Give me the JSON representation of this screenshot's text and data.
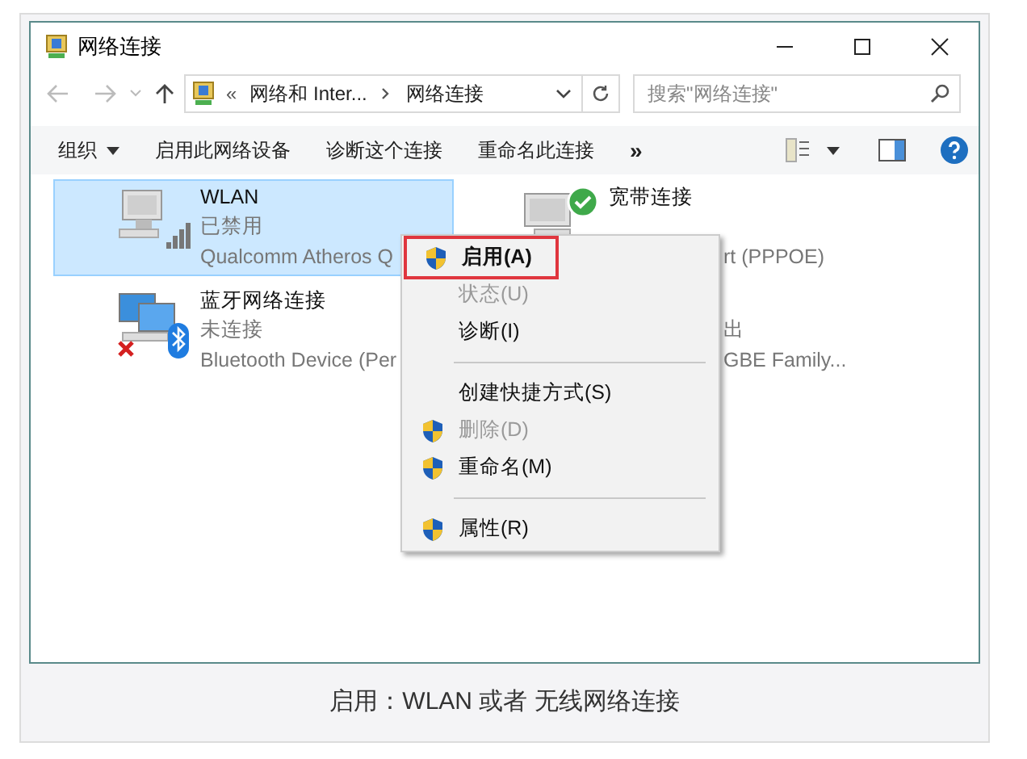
{
  "window": {
    "title": "网络连接"
  },
  "address_bar": {
    "overflow": "«",
    "segments": [
      "网络和 Inter...",
      "网络连接"
    ]
  },
  "search": {
    "placeholder": "搜索\"网络连接\""
  },
  "toolbar": [
    {
      "label": "组织",
      "kind": "dropdown"
    },
    {
      "label": "启用此网络设备",
      "kind": "button"
    },
    {
      "label": "诊断这个连接",
      "kind": "button"
    },
    {
      "label": "重命名此连接",
      "kind": "button"
    },
    {
      "label": "»",
      "kind": "more"
    }
  ],
  "connections": [
    {
      "name": "WLAN",
      "status": "已禁用",
      "device": "Qualcomm Atheros Q",
      "kind": "wireless",
      "selected": true,
      "covered": false
    },
    {
      "name": "宽带连接",
      "device": "rt (PPPOE)",
      "kind": "broadband",
      "selected": false,
      "covered": true
    },
    {
      "name": "蓝牙网络连接",
      "status": "未连接",
      "device": "Bluetooth Device (Per",
      "kind": "bluetooth",
      "selected": false,
      "covered": false
    },
    {
      "status": "出",
      "device": "GBE Family...",
      "kind": "ethernet",
      "selected": false,
      "covered": true
    }
  ],
  "context_menu": [
    {
      "kind": "item",
      "label": "启用(A)",
      "shield": true,
      "disabled": false,
      "default": true,
      "highlighted": true
    },
    {
      "kind": "item",
      "label": "状态(U)",
      "shield": false,
      "disabled": true,
      "default": false,
      "highlighted": false
    },
    {
      "kind": "item",
      "label": "诊断(I)",
      "shield": false,
      "disabled": false,
      "default": false,
      "highlighted": false
    },
    {
      "kind": "separator"
    },
    {
      "kind": "item",
      "label": "创建快捷方式(S)",
      "shield": false,
      "disabled": false,
      "default": false,
      "highlighted": false
    },
    {
      "kind": "item",
      "label": "删除(D)",
      "shield": true,
      "disabled": true,
      "default": false,
      "highlighted": false
    },
    {
      "kind": "item",
      "label": "重命名(M)",
      "shield": true,
      "disabled": false,
      "default": false,
      "highlighted": false
    },
    {
      "kind": "separator"
    },
    {
      "kind": "item",
      "label": "属性(R)",
      "shield": true,
      "disabled": false,
      "default": false,
      "highlighted": false
    }
  ],
  "caption": "启用：WLAN 或者 无线网络连接"
}
